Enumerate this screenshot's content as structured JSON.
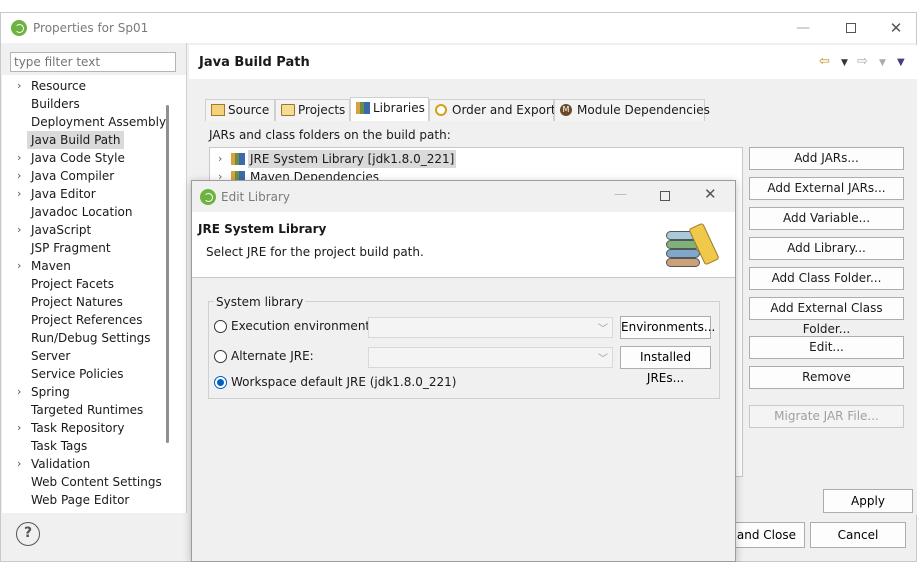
{
  "window": {
    "title": "Properties for Sp01"
  },
  "filter": {
    "placeholder": "type filter text"
  },
  "tree": [
    {
      "label": "Resource",
      "expandable": true
    },
    {
      "label": "Builders",
      "expandable": false
    },
    {
      "label": "Deployment Assembly",
      "expandable": false
    },
    {
      "label": "Java Build Path",
      "expandable": false,
      "selected": true
    },
    {
      "label": "Java Code Style",
      "expandable": true
    },
    {
      "label": "Java Compiler",
      "expandable": true
    },
    {
      "label": "Java Editor",
      "expandable": true
    },
    {
      "label": "Javadoc Location",
      "expandable": false
    },
    {
      "label": "JavaScript",
      "expandable": true
    },
    {
      "label": "JSP Fragment",
      "expandable": false
    },
    {
      "label": "Maven",
      "expandable": true
    },
    {
      "label": "Project Facets",
      "expandable": false
    },
    {
      "label": "Project Natures",
      "expandable": false
    },
    {
      "label": "Project References",
      "expandable": false
    },
    {
      "label": "Run/Debug Settings",
      "expandable": false
    },
    {
      "label": "Server",
      "expandable": false
    },
    {
      "label": "Service Policies",
      "expandable": false
    },
    {
      "label": "Spring",
      "expandable": true
    },
    {
      "label": "Targeted Runtimes",
      "expandable": false
    },
    {
      "label": "Task Repository",
      "expandable": true
    },
    {
      "label": "Task Tags",
      "expandable": false
    },
    {
      "label": "Validation",
      "expandable": true
    },
    {
      "label": "Web Content Settings",
      "expandable": false
    },
    {
      "label": "Web Page Editor",
      "expandable": false
    }
  ],
  "page": {
    "title": "Java Build Path",
    "tabs": [
      {
        "label": "Source"
      },
      {
        "label": "Projects"
      },
      {
        "label": "Libraries",
        "active": true
      },
      {
        "label": "Order and Export"
      },
      {
        "label": "Module Dependencies"
      }
    ],
    "jars_label": "JARs and class folders on the build path:",
    "entries": [
      {
        "label": "JRE System Library [jdk1.8.0_221]",
        "selected": true
      },
      {
        "label": "Maven Dependencies"
      }
    ],
    "side_buttons": [
      {
        "label": "Add JARs...",
        "enabled": true
      },
      {
        "label": "Add External JARs...",
        "enabled": true
      },
      {
        "label": "Add Variable...",
        "enabled": true
      },
      {
        "label": "Add Library...",
        "enabled": true
      },
      {
        "label": "Add Class Folder...",
        "enabled": true
      },
      {
        "label": "Add External Class Folder...",
        "enabled": true
      },
      {
        "label": "Edit...",
        "enabled": true
      },
      {
        "label": "Remove",
        "enabled": true
      },
      {
        "label": "Migrate JAR File...",
        "enabled": false
      }
    ],
    "apply_label": "Apply"
  },
  "footer": {
    "help_label": "?",
    "apply_close_label": "Apply and Close",
    "cancel_label": "Cancel"
  },
  "dialog": {
    "title": "Edit Library",
    "heading": "JRE System Library",
    "description": "Select JRE for the project build path.",
    "group_label": "System library",
    "options": [
      {
        "label": "Execution environment:",
        "checked": false,
        "button": "Environments..."
      },
      {
        "label": "Alternate JRE:",
        "checked": false,
        "button": "Installed JREs..."
      },
      {
        "label": "Workspace default JRE (jdk1.8.0_221)",
        "checked": true
      }
    ]
  },
  "colors": {
    "accent": "#0060c0",
    "spring_green": "#6db33f",
    "selection": "#dadada"
  }
}
